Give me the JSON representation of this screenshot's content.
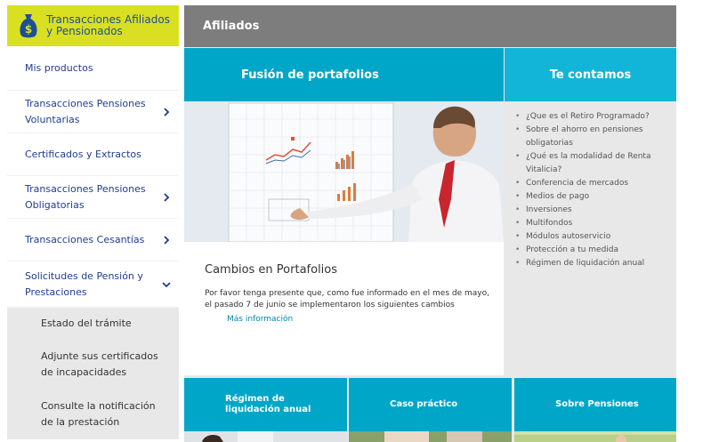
{
  "sidebar": {
    "header_title": "Transacciones Afiliados y Pensionados",
    "items": [
      {
        "label": "Mis productos"
      },
      {
        "label": "Transacciones Pensiones Voluntarias"
      },
      {
        "label": "Certificados y Extractos"
      },
      {
        "label": "Transacciones Pensiones Obligatorias"
      },
      {
        "label": "Transacciones Cesantías"
      },
      {
        "label": "Solicitudes de Pensión y Prestaciones"
      }
    ],
    "subitems": [
      {
        "label": "Estado del trámite"
      },
      {
        "label": "Adjunte sus certificados de incapacidades"
      },
      {
        "label": "Consulte la notificación de la prestación"
      }
    ]
  },
  "main": {
    "header": "Afiliados",
    "card": {
      "title": "Fusión de portafolios",
      "subtitle": "Cambios en Portafolios",
      "text": "Por favor tenga presente que, como fue informado en el mes de mayo, el pasado 7 de junio se implementaron los siguientes cambios",
      "link": "Más información"
    },
    "te_contamos": {
      "title": "Te contamos",
      "items": [
        "¿Que es el Retiro Programado?",
        "Sobre el ahorro en pensiones obligatorias",
        "¿Qué es la modalidad de Renta Vitalicia?",
        "Conferencia de mercados",
        "Medios de pago",
        "Inversiones",
        "Multifondos",
        "Módulos autoservicio",
        "Protección a tu medida",
        "Régimen de liquidación anual"
      ]
    },
    "tiles": [
      {
        "label": "Régimen de liquidación anual"
      },
      {
        "label": "Caso práctico"
      },
      {
        "label": "Sobre Pensiones"
      }
    ]
  },
  "colors": {
    "sidebar_header_bg": "#d9e021",
    "sidebar_text": "#1f3d8f",
    "main_header_bg": "#7d7d7d",
    "card_header_bg": "#00a6c8",
    "te_contamos_bg": "#12b5d7",
    "link": "#0086a8"
  }
}
